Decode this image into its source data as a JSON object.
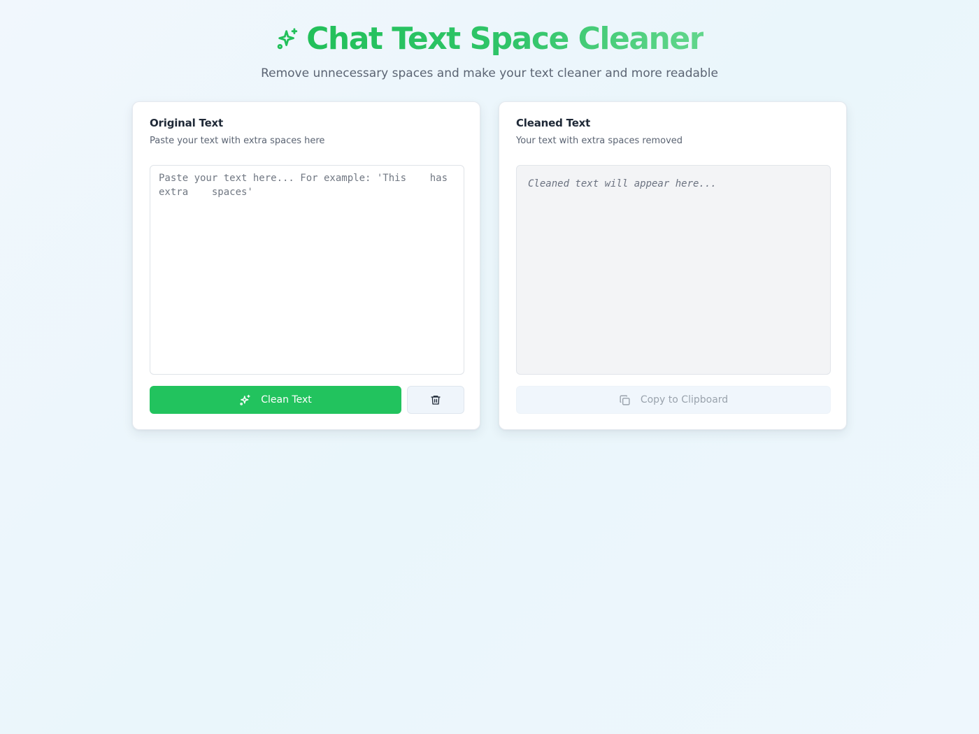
{
  "header": {
    "title": "Chat Text Space Cleaner",
    "subtitle": "Remove unnecessary spaces and make your text cleaner and more readable",
    "title_icon": "sparkles-icon"
  },
  "original_panel": {
    "title": "Original Text",
    "description": "Paste your text with extra spaces here",
    "input_value": "",
    "input_placeholder": "Paste your text here... For example: 'This    has extra    spaces'",
    "clean_button_label": "Clean Text",
    "clean_button_icon": "sparkles-icon",
    "clear_button_icon": "trash-icon"
  },
  "cleaned_panel": {
    "title": "Cleaned Text",
    "description": "Your text with extra spaces removed",
    "output_placeholder": "Cleaned text will appear here...",
    "copy_button_label": "Copy to Clipboard",
    "copy_button_icon": "copy-icon"
  },
  "colors": {
    "accent": "#22c35e",
    "title_gradient_start": "#22c05a",
    "title_gradient_end": "#62d68c",
    "output_bg": "#f3f4f6",
    "copy_button_bg": "#f0f6fc"
  }
}
